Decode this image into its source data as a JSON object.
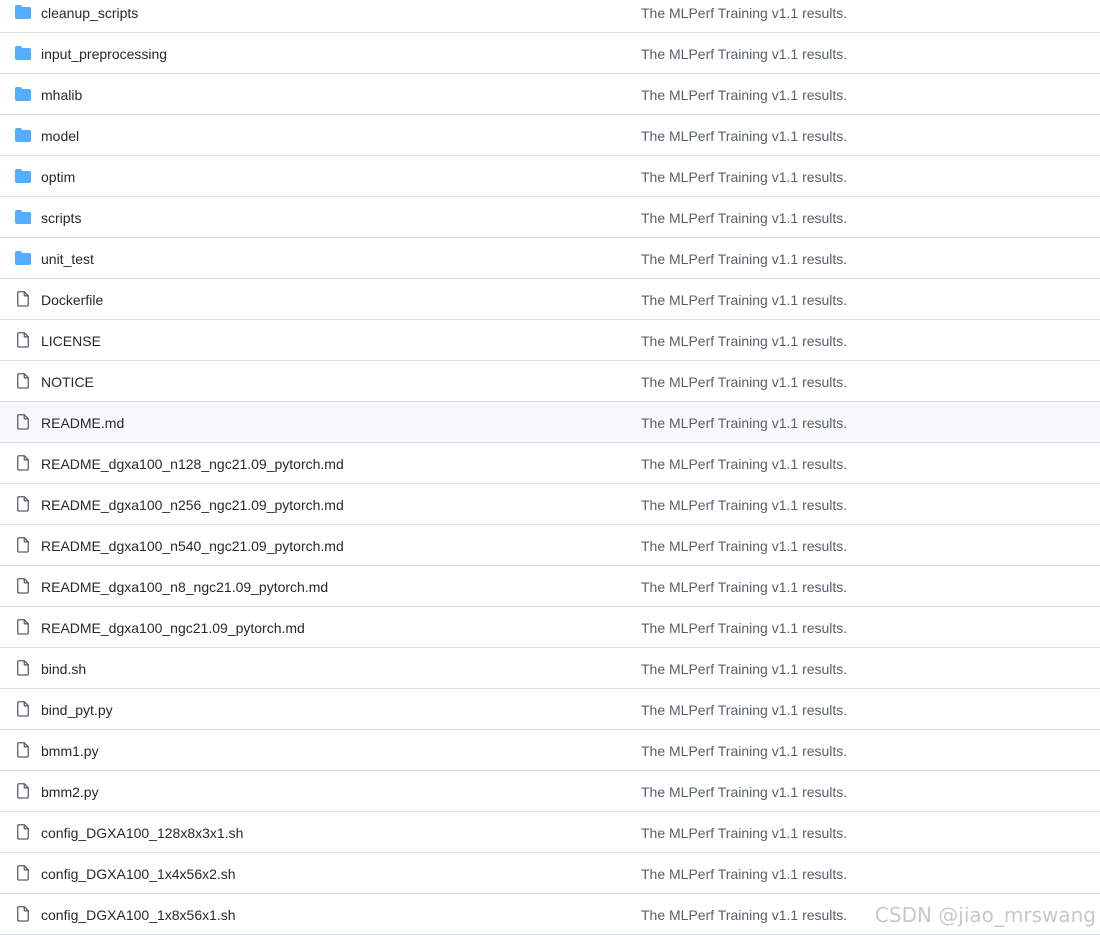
{
  "colors": {
    "folder_icon": "#54aeff",
    "file_icon": "#57606a",
    "border": "#d8dee4",
    "highlight_row": "#f6f8fa",
    "message_text": "#57606a"
  },
  "files": [
    {
      "name": "cleanup_scripts",
      "type": "folder",
      "icon": "folder-icon",
      "message": "The MLPerf Training v1.1 results."
    },
    {
      "name": "input_preprocessing",
      "type": "folder",
      "icon": "folder-icon",
      "message": "The MLPerf Training v1.1 results."
    },
    {
      "name": "mhalib",
      "type": "folder",
      "icon": "folder-icon",
      "message": "The MLPerf Training v1.1 results."
    },
    {
      "name": "model",
      "type": "folder",
      "icon": "folder-icon",
      "message": "The MLPerf Training v1.1 results."
    },
    {
      "name": "optim",
      "type": "folder",
      "icon": "folder-icon",
      "message": "The MLPerf Training v1.1 results."
    },
    {
      "name": "scripts",
      "type": "folder",
      "icon": "folder-icon",
      "message": "The MLPerf Training v1.1 results."
    },
    {
      "name": "unit_test",
      "type": "folder",
      "icon": "folder-icon",
      "message": "The MLPerf Training v1.1 results."
    },
    {
      "name": "Dockerfile",
      "type": "file",
      "icon": "file-icon",
      "message": "The MLPerf Training v1.1 results."
    },
    {
      "name": "LICENSE",
      "type": "file",
      "icon": "file-icon",
      "message": "The MLPerf Training v1.1 results."
    },
    {
      "name": "NOTICE",
      "type": "file",
      "icon": "file-icon",
      "message": "The MLPerf Training v1.1 results."
    },
    {
      "name": "README.md",
      "type": "file",
      "icon": "file-icon",
      "message": "The MLPerf Training v1.1 results.",
      "highlighted": true
    },
    {
      "name": "README_dgxa100_n128_ngc21.09_pytorch.md",
      "type": "file",
      "icon": "file-icon",
      "message": "The MLPerf Training v1.1 results."
    },
    {
      "name": "README_dgxa100_n256_ngc21.09_pytorch.md",
      "type": "file",
      "icon": "file-icon",
      "message": "The MLPerf Training v1.1 results."
    },
    {
      "name": "README_dgxa100_n540_ngc21.09_pytorch.md",
      "type": "file",
      "icon": "file-icon",
      "message": "The MLPerf Training v1.1 results."
    },
    {
      "name": "README_dgxa100_n8_ngc21.09_pytorch.md",
      "type": "file",
      "icon": "file-icon",
      "message": "The MLPerf Training v1.1 results."
    },
    {
      "name": "README_dgxa100_ngc21.09_pytorch.md",
      "type": "file",
      "icon": "file-icon",
      "message": "The MLPerf Training v1.1 results."
    },
    {
      "name": "bind.sh",
      "type": "file",
      "icon": "file-icon",
      "message": "The MLPerf Training v1.1 results."
    },
    {
      "name": "bind_pyt.py",
      "type": "file",
      "icon": "file-icon",
      "message": "The MLPerf Training v1.1 results."
    },
    {
      "name": "bmm1.py",
      "type": "file",
      "icon": "file-icon",
      "message": "The MLPerf Training v1.1 results."
    },
    {
      "name": "bmm2.py",
      "type": "file",
      "icon": "file-icon",
      "message": "The MLPerf Training v1.1 results."
    },
    {
      "name": "config_DGXA100_128x8x3x1.sh",
      "type": "file",
      "icon": "file-icon",
      "message": "The MLPerf Training v1.1 results."
    },
    {
      "name": "config_DGXA100_1x4x56x2.sh",
      "type": "file",
      "icon": "file-icon",
      "message": "The MLPerf Training v1.1 results."
    },
    {
      "name": "config_DGXA100_1x8x56x1.sh",
      "type": "file",
      "icon": "file-icon",
      "message": "The MLPerf Training v1.1 results."
    }
  ],
  "watermark": "CSDN @jiao_mrswang"
}
